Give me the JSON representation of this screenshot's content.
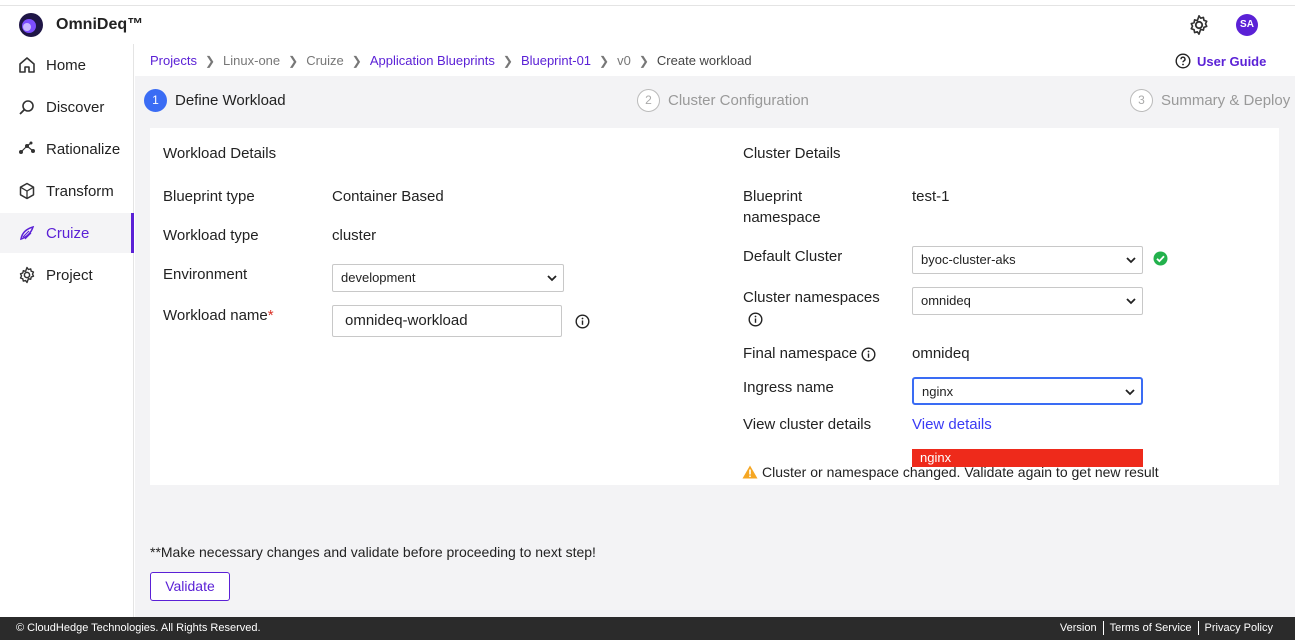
{
  "app": {
    "title": "OmniDeq™",
    "avatar_initials": "SA",
    "accent": "#5b21d6"
  },
  "sidebar": {
    "items": [
      {
        "label": "Home",
        "icon": "home-icon"
      },
      {
        "label": "Discover",
        "icon": "discover-icon"
      },
      {
        "label": "Rationalize",
        "icon": "rationalize-icon"
      },
      {
        "label": "Transform",
        "icon": "transform-icon"
      },
      {
        "label": "Cruize",
        "icon": "cruize-icon",
        "active": true
      },
      {
        "label": "Project",
        "icon": "project-icon"
      }
    ]
  },
  "breadcrumb": {
    "items": [
      "Projects",
      "Linux-one",
      "Cruize",
      "Application Blueprints",
      "Blueprint-01",
      "v0",
      "Create workload"
    ]
  },
  "user_guide": "User Guide",
  "steps": [
    {
      "num": "1",
      "label": "Define Workload",
      "active": true
    },
    {
      "num": "2",
      "label": "Cluster Configuration"
    },
    {
      "num": "3",
      "label": "Summary & Deploy"
    }
  ],
  "workload": {
    "heading": "Workload Details",
    "blueprint_type_label": "Blueprint type",
    "blueprint_type_value": "Container Based",
    "workload_type_label": "Workload type",
    "workload_type_value": "cluster",
    "environment_label": "Environment",
    "environment_value": "development",
    "workload_name_label": "Workload name",
    "workload_name_required": "*",
    "workload_name_value": "omnideq-workload"
  },
  "cluster": {
    "heading": "Cluster Details",
    "namespace_label_1": "Blueprint",
    "namespace_label_2": "namespace",
    "namespace_value": "test-1",
    "default_cluster_label": "Default Cluster",
    "default_cluster_value": "byoc-cluster-aks",
    "cluster_namespaces_label": "Cluster namespaces",
    "cluster_namespaces_value": "omnideq",
    "final_namespace_label": "Final namespace",
    "final_namespace_value": "omnideq",
    "ingress_label": "Ingress name",
    "ingress_value": "nginx",
    "ingress_option": "nginx",
    "view_details_label": "View cluster details",
    "view_details_link": "View details",
    "warning": "Cluster or namespace changed. Validate again to get new result"
  },
  "note": "**Make necessary changes and validate before proceeding to next step!",
  "validate_button": "Validate",
  "footer": {
    "copyright": "© CloudHedge Technologies. All Rights Reserved.",
    "links": [
      "Version",
      "Terms of Service",
      "Privacy Policy"
    ]
  }
}
